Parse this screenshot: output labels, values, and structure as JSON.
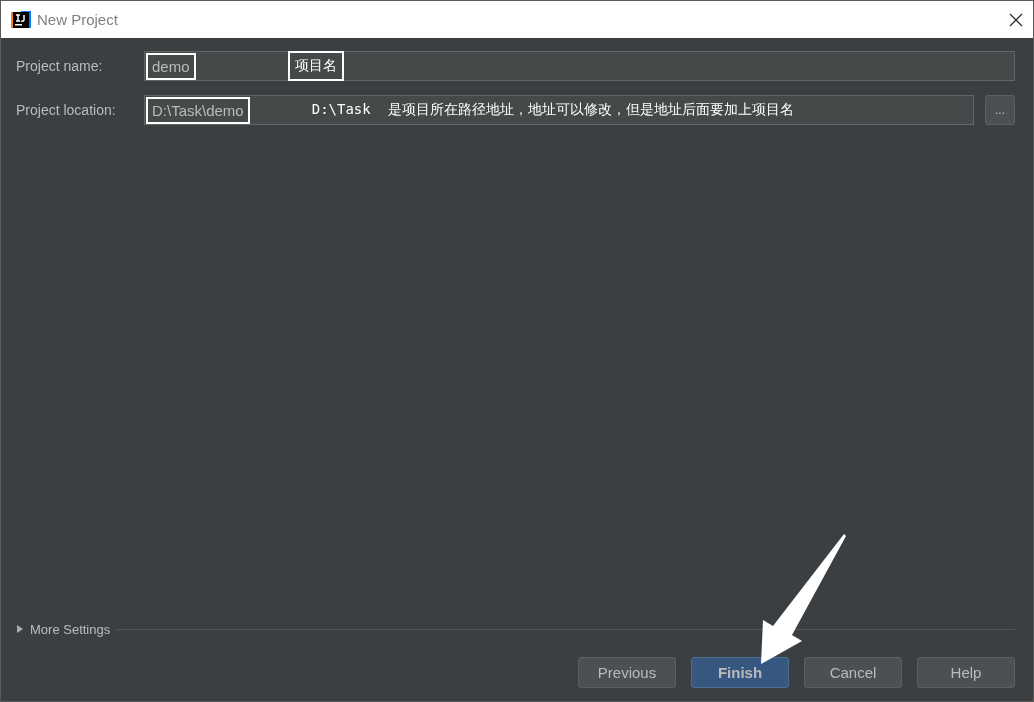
{
  "window": {
    "title": "New Project"
  },
  "fields": [
    {
      "label": "Project name:",
      "value": "demo",
      "highlighted": true,
      "note": "项目名",
      "browse": false
    },
    {
      "label": "Project location:",
      "value": "D:\\Task\\demo",
      "highlighted": true,
      "note": "D:\\Task  是项目所在路径地址，地址可以修改，但是地址后面要加上项目名",
      "browse": true,
      "browse_label": "..."
    }
  ],
  "more_settings": {
    "label": "More Settings",
    "expanded": false
  },
  "buttons": [
    {
      "label": "Previous",
      "default": false
    },
    {
      "label": "Finish",
      "default": true
    },
    {
      "label": "Cancel",
      "default": false
    },
    {
      "label": "Help",
      "default": false
    }
  ]
}
